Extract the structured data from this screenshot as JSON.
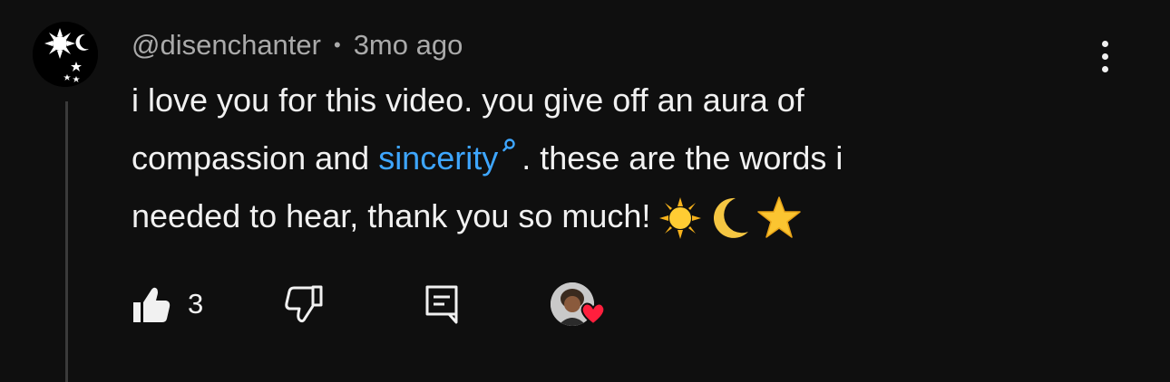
{
  "comment": {
    "author": "@disenchanter",
    "separator": "•",
    "timestamp": "3mo ago",
    "text_line1": "i love you for this video. you give off an aura of",
    "text_line2_pre": "compassion and",
    "link_text": "sincerity",
    "text_line2_post": ". these are the words i",
    "text_line3": "needed to hear, thank you so much!",
    "emojis": [
      "sun-emoji",
      "crescent-moon-emoji",
      "star-emoji"
    ]
  },
  "actions": {
    "like_count": "3",
    "like_icon": "thumbs-up-icon",
    "dislike_icon": "thumbs-down-icon",
    "reply_icon": "comment-reply-icon",
    "creator_heart_icon": "creator-heart-icon"
  },
  "colors": {
    "background": "#0f0f0f",
    "text": "#f1f1f1",
    "muted": "#aaaaaa",
    "link": "#3ea6ff",
    "heart": "#ff1f3d"
  }
}
